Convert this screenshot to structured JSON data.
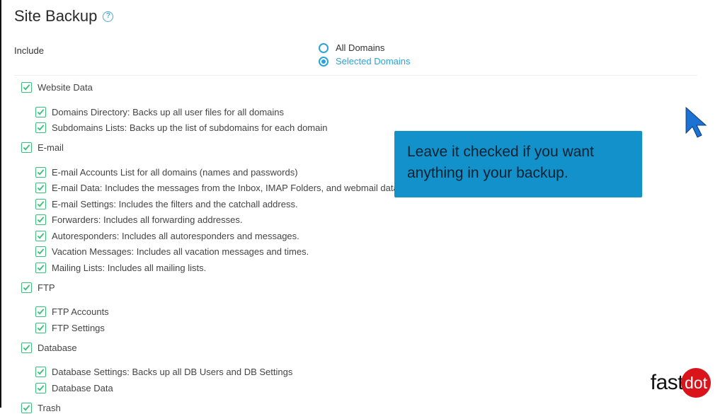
{
  "title": "Site Backup",
  "include_label": "Include",
  "domain_radios": {
    "all": "All Domains",
    "selected": "Selected Domains"
  },
  "tree": {
    "website_data": "Website Data",
    "domains_dir": "Domains Directory: Backs up all user files for all domains",
    "subdomains": "Subdomains Lists: Backs up the list of subdomains for each domain",
    "email": "E-mail",
    "email_accounts": "E-mail Accounts List for all domains (names and passwords)",
    "email_data": "E-mail Data: Includes the messages from the Inbox, IMAP Folders, and webmail data.",
    "email_settings": "E-mail Settings: Includes the filters and the catchall address.",
    "forwarders": "Forwarders: Includes all forwarding addresses.",
    "autoresponders": "Autoresponders: Includes all autoresponders and messages.",
    "vacation": "Vacation Messages: Includes all vacation messages and times.",
    "mailing": "Mailing Lists: Includes all mailing lists.",
    "ftp": "FTP",
    "ftp_accounts": "FTP Accounts",
    "ftp_settings": "FTP Settings",
    "database": "Database",
    "db_settings": "Database Settings: Backs up all DB Users and DB Settings",
    "db_data": "Database Data",
    "trash": "Trash"
  },
  "callout": "Leave it checked if you want anything in your backup.",
  "logo": {
    "fast": "fast",
    "dot": "dot"
  }
}
